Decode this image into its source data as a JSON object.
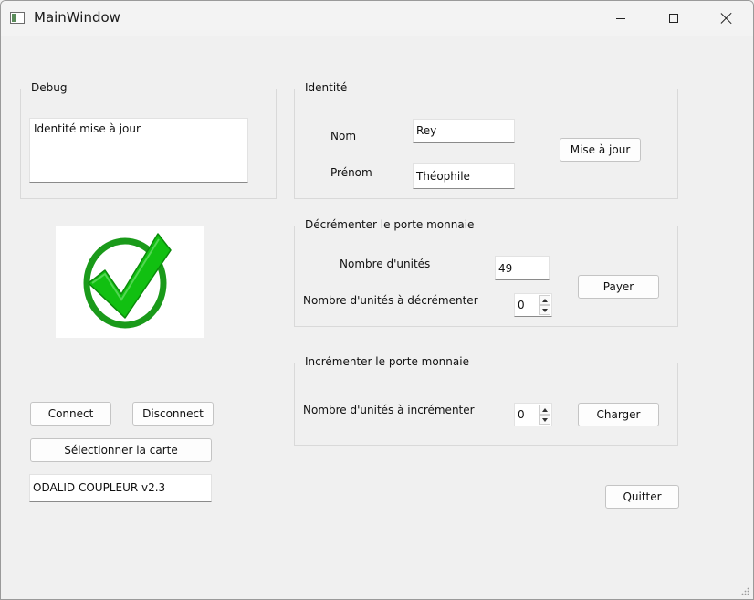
{
  "window": {
    "title": "MainWindow",
    "icons": {
      "app": "app-window-icon",
      "minimize": "minimize-icon",
      "maximize": "maximize-icon",
      "close": "close-icon"
    }
  },
  "debug": {
    "group_title": "Debug",
    "message": "Identité mise à jour"
  },
  "status_image": {
    "icon": "checkmark-icon",
    "colors": {
      "ring": "#1a9a1a",
      "check": "#11c011"
    }
  },
  "connection": {
    "connect_label": "Connect",
    "disconnect_label": "Disconnect",
    "select_card_label": "Sélectionner la carte",
    "reader_version": "ODALID COUPLEUR v2.3"
  },
  "identity": {
    "group_title": "Identité",
    "nom_label": "Nom",
    "nom_value": "Rey",
    "prenom_label": "Prénom",
    "prenom_value": "Théophile",
    "update_label": "Mise à jour"
  },
  "decrement": {
    "group_title": "Décrémenter le porte monnaie",
    "units_label": "Nombre d'unités",
    "units_value": "49",
    "decrement_label": "Nombre d'unités à décrémenter",
    "decrement_value": "0",
    "pay_label": "Payer"
  },
  "increment": {
    "group_title": "Incrémenter le porte monnaie",
    "increment_label": "Nombre d'unités à incrémenter",
    "increment_value": "0",
    "charge_label": "Charger"
  },
  "quit_label": "Quitter"
}
